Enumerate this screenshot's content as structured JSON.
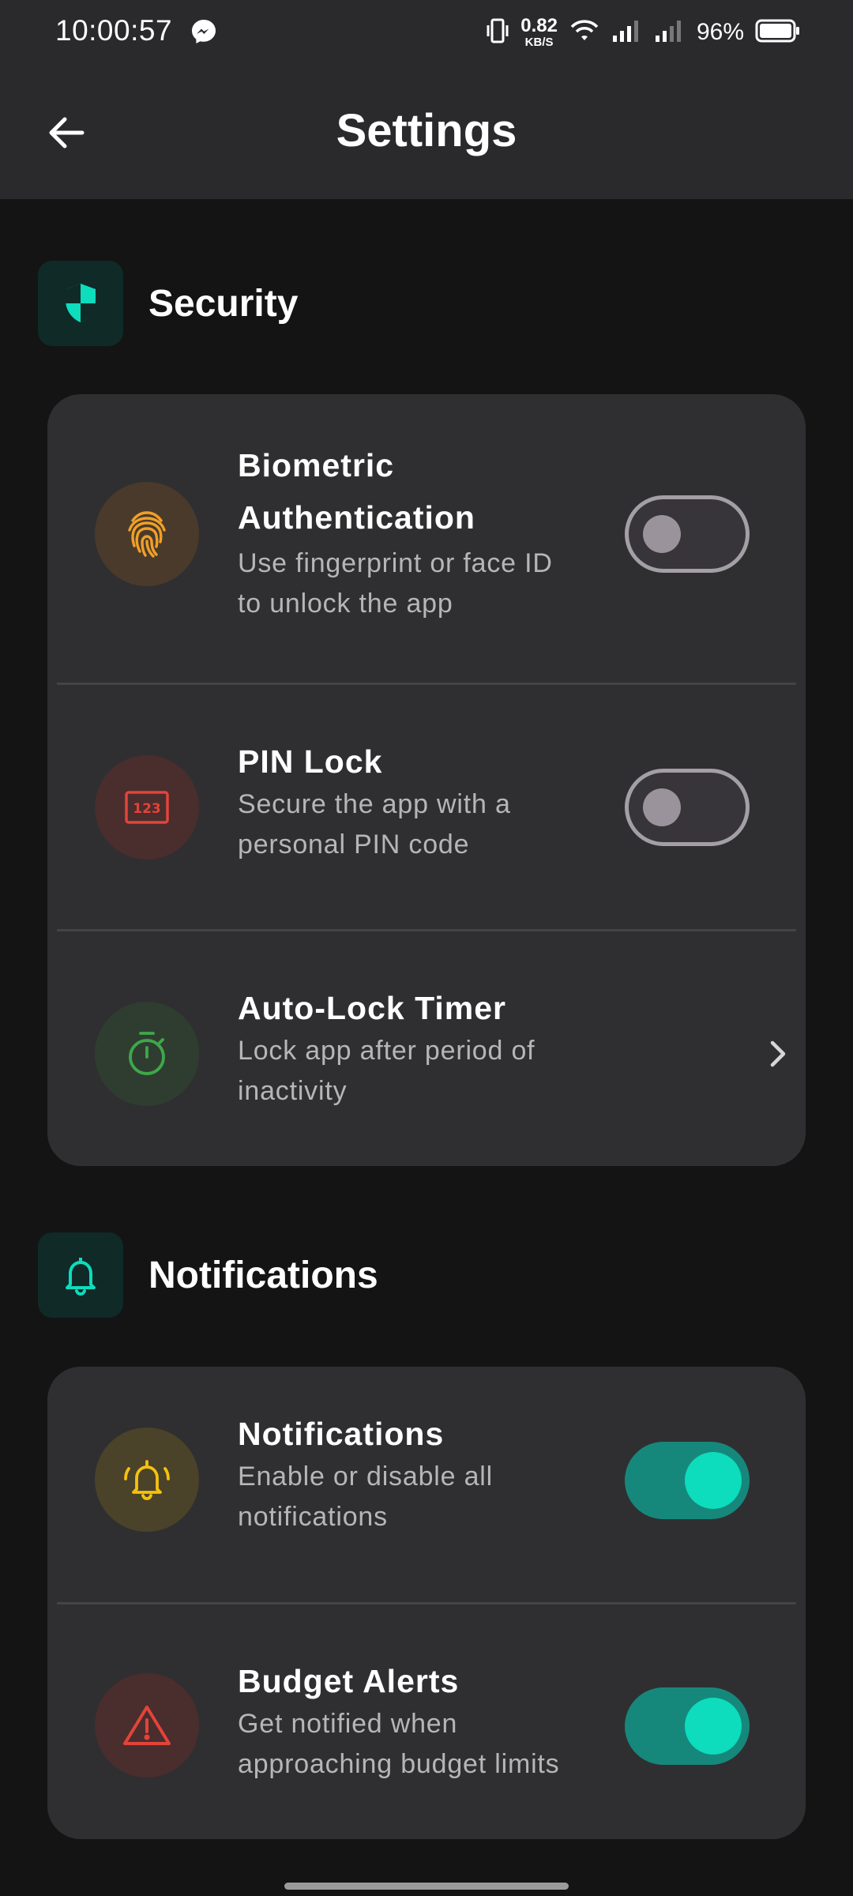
{
  "status_bar": {
    "time": "10:00:57",
    "net_speed_value": "0.82",
    "net_speed_unit": "KB/S",
    "battery": "96%",
    "icons": [
      "messenger-icon",
      "vibrate-icon",
      "wifi-icon",
      "signal-icon",
      "signal-icon",
      "battery-icon"
    ]
  },
  "app_bar": {
    "title": "Settings",
    "back_icon": "arrow-left-icon"
  },
  "sections": {
    "security": {
      "title": "Security",
      "icon": "shield-icon",
      "items": [
        {
          "title_line1": "Biometric",
          "title_line2": "Authentication",
          "sub_line1": "Use fingerprint or face ID",
          "sub_line2": "to unlock the app",
          "icon": "fingerprint-icon",
          "control": "toggle",
          "enabled": false
        },
        {
          "title": "PIN Lock",
          "sub_line1": "Secure the app with a",
          "sub_line2": "personal PIN code",
          "icon": "pin-123-icon",
          "control": "toggle",
          "enabled": false
        },
        {
          "title": "Auto-Lock Timer",
          "sub_line1": "Lock app after period of",
          "sub_line2": "inactivity",
          "icon": "stopwatch-icon",
          "control": "chevron"
        }
      ]
    },
    "notifications": {
      "title": "Notifications",
      "icon": "bell-icon",
      "items": [
        {
          "title": "Notifications",
          "sub_line1": "Enable or disable all",
          "sub_line2": "notifications",
          "icon": "bell-ringing-icon",
          "control": "toggle",
          "enabled": true
        },
        {
          "title": "Budget Alerts",
          "sub_line1": "Get notified when",
          "sub_line2": "approaching budget limits",
          "icon": "warning-triangle-icon",
          "control": "toggle",
          "enabled": true
        }
      ]
    }
  },
  "colors": {
    "accent": "#0ddcbd",
    "toggle_on_track": "#16887b",
    "fingerprint": "#f0a028",
    "pin": "#e2443a",
    "timer": "#3ea84a",
    "bell": "#f4c20d",
    "warning": "#e2443a"
  }
}
